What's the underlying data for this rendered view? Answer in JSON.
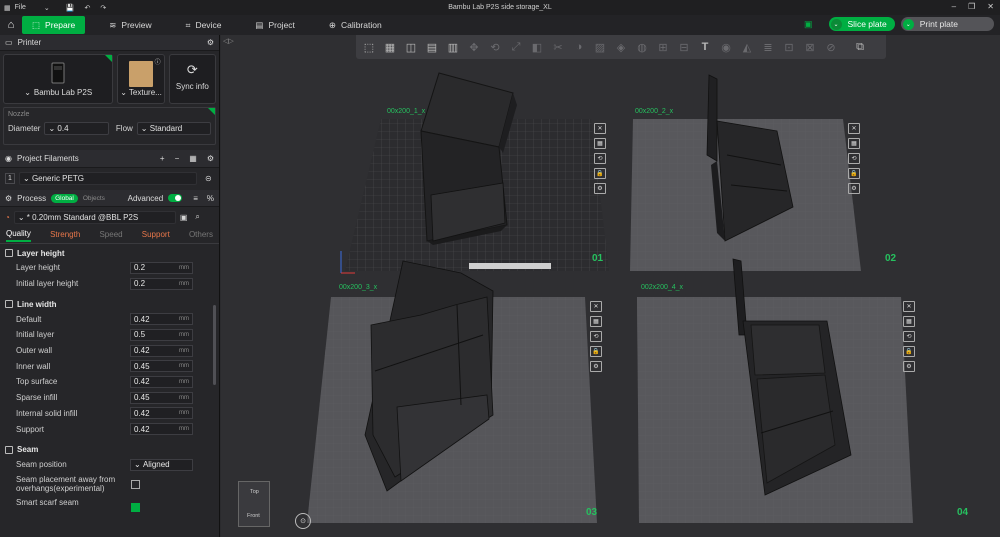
{
  "window": {
    "title": "Bambu Lab P2S side storage_XL",
    "file_menu": "File"
  },
  "tabs": [
    {
      "label": "Prepare",
      "active": true
    },
    {
      "label": "Preview",
      "active": false
    },
    {
      "label": "Device",
      "active": false
    },
    {
      "label": "Project",
      "active": false
    },
    {
      "label": "Calibration",
      "active": false
    }
  ],
  "actions": {
    "slice": "Slice plate",
    "print": "Print plate"
  },
  "printer": {
    "section": "Printer",
    "name": "Bambu Lab P2S",
    "plate": "Texture...",
    "sync": "Sync info",
    "nozzle_label": "Nozzle",
    "diameter_label": "Diameter",
    "diameter": "0.4",
    "flow_label": "Flow",
    "flow": "Standard"
  },
  "filaments": {
    "section": "Project Filaments",
    "items": [
      {
        "num": "1",
        "name": "Generic PETG"
      }
    ]
  },
  "process": {
    "section": "Process",
    "global": "Global",
    "objects": "Objects",
    "advanced": "Advanced",
    "preset": "* 0.20mm Standard @BBL P2S",
    "tabs": [
      "Quality",
      "Strength",
      "Speed",
      "Support",
      "Others"
    ]
  },
  "params": {
    "layer_height": {
      "title": "Layer height",
      "rows": [
        {
          "label": "Layer height",
          "value": "0.2",
          "unit": "mm"
        },
        {
          "label": "Initial layer height",
          "value": "0.2",
          "unit": "mm"
        }
      ]
    },
    "line_width": {
      "title": "Line width",
      "rows": [
        {
          "label": "Default",
          "value": "0.42",
          "unit": "mm"
        },
        {
          "label": "Initial layer",
          "value": "0.5",
          "unit": "mm"
        },
        {
          "label": "Outer wall",
          "value": "0.42",
          "unit": "mm"
        },
        {
          "label": "Inner wall",
          "value": "0.45",
          "unit": "mm"
        },
        {
          "label": "Top surface",
          "value": "0.42",
          "unit": "mm"
        },
        {
          "label": "Sparse infill",
          "value": "0.45",
          "unit": "mm"
        },
        {
          "label": "Internal solid infill",
          "value": "0.42",
          "unit": "mm"
        },
        {
          "label": "Support",
          "value": "0.42",
          "unit": "mm"
        }
      ]
    },
    "seam": {
      "title": "Seam",
      "position_label": "Seam position",
      "position_value": "Aligned",
      "placement_label_1": "Seam placement away from",
      "placement_label_2": "overhangs(experimental)",
      "scarf_label": "Smart scarf seam"
    }
  },
  "plates": [
    {
      "label": "00x200_1_x",
      "num": "01"
    },
    {
      "label": "00x200_2_x",
      "num": "02"
    },
    {
      "label": "00x200_3_x",
      "num": "03"
    },
    {
      "label": "002x200_4_x",
      "num": "04"
    }
  ],
  "navcube": {
    "top": "Top",
    "front": "Front"
  },
  "colors": {
    "accent": "#00ae42",
    "orange": "#e8774a",
    "plate_text": "#26c15f"
  }
}
